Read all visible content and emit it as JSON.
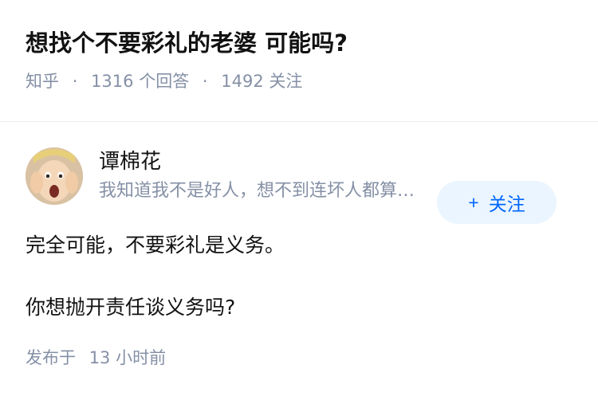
{
  "question": {
    "title": "想找个不要彩礼的老婆 可能吗?",
    "source": "知乎",
    "separator": "·",
    "answers_count": "1316",
    "answers_label": "个回答",
    "followers_count": "1492",
    "followers_label": "关注"
  },
  "answer": {
    "author_name": "谭棉花",
    "author_bio": "我知道我不是好人，想不到连坏人都算不上……",
    "follow_button": {
      "icon": "+",
      "label": "关注"
    },
    "paragraphs": [
      "完全可能，不要彩礼是义务。",
      "你想抛开责任谈义务吗?"
    ],
    "published_label": "发布于",
    "published_time": "13 小时前"
  },
  "colors": {
    "meta_gray": "#8590a6",
    "accent_blue": "#0066ff",
    "button_bg": "#ebf5ff"
  }
}
